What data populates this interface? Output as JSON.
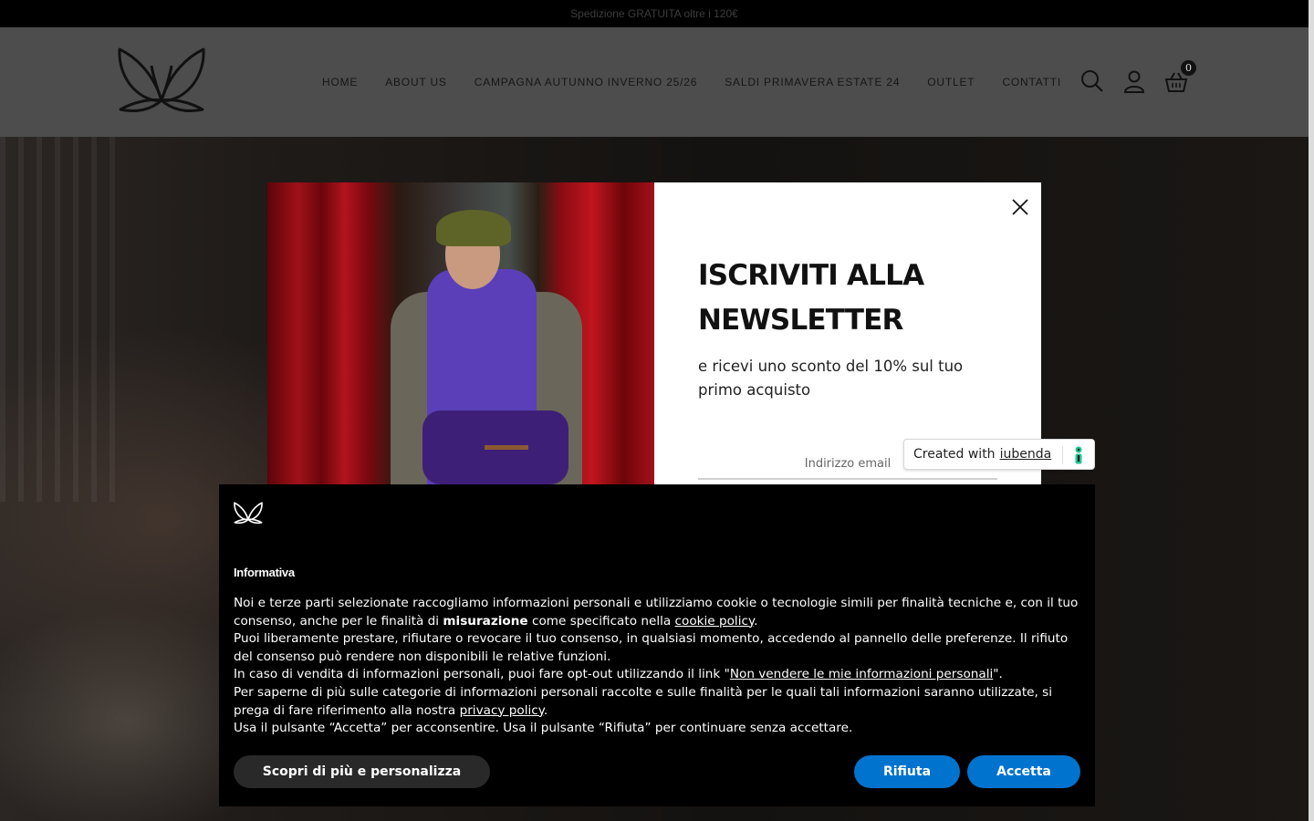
{
  "announcement": {
    "text": "Spedizione GRATUITA oltre i 120€"
  },
  "header": {
    "nav": [
      {
        "label": "HOME"
      },
      {
        "label": "ABOUT US"
      },
      {
        "label": "CAMPAGNA AUTUNNO INVERNO 25/26"
      },
      {
        "label": "SALDI PRIMAVERA ESTATE 24"
      },
      {
        "label": "OUTLET"
      },
      {
        "label": "CONTATTI"
      }
    ],
    "icons": [
      "search-icon",
      "user-icon",
      "basket-icon"
    ],
    "cart_count": "0"
  },
  "newsletter": {
    "title_line1": "ISCRIVITI ALLA",
    "title_line2": "NEWSLETTER",
    "subtitle": "e ricevi uno sconto del 10% sul tuo primo acquisto",
    "email_placeholder": "Indirizzo email"
  },
  "iubenda_badge": {
    "prefix": "Created with ",
    "link": "iubenda"
  },
  "cookie_banner": {
    "title": "Informativa",
    "p1_a": "Noi e terze parti selezionate raccogliamo informazioni personali e utilizziamo cookie o tecnologie simili per finalità tecniche e, con il tuo consenso, anche per le finalità di ",
    "p1_bold": "misurazione",
    "p1_b": " come specificato nella ",
    "p1_link": "cookie policy",
    "p1_c": ".",
    "p2": "Puoi liberamente prestare, rifiutare o revocare il tuo consenso, in qualsiasi momento, accedendo al pannello delle preferenze. Il rifiuto del consenso può rendere non disponibili le relative funzioni.",
    "p3_a": "In caso di vendita di informazioni personali, puoi fare opt-out utilizzando il link \"",
    "p3_link": "Non vendere le mie informazioni personali",
    "p3_b": "\".",
    "p4_a": "Per saperne di più sulle categorie di informazioni personali raccolte e sulle finalità per le quali tali informazioni saranno utilizzate, si prega di fare riferimento alla nostra ",
    "p4_link": "privacy policy",
    "p4_b": ".",
    "p5": "Usa il pulsante “Accetta” per acconsentire. Usa il pulsante “Rifiuta” per continuare senza accettare.",
    "btn_more": "Scopri di più e personalizza",
    "btn_reject": "Rifiuta",
    "btn_accept": "Accetta"
  },
  "colors": {
    "accent_blue": "#0073ce",
    "header_bg": "#4d4d4d",
    "banner_bg": "#000000"
  }
}
